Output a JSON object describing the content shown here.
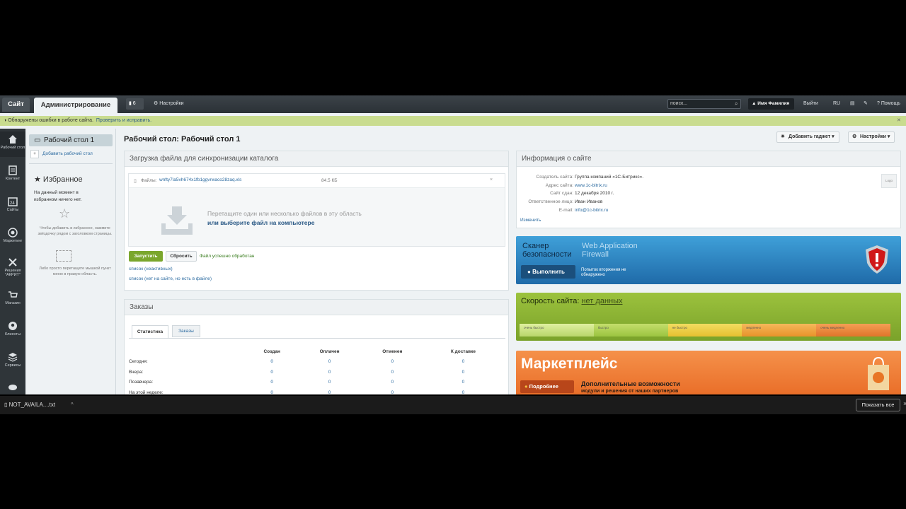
{
  "topbar": {
    "site": "Сайт",
    "admin": "Администрирование",
    "notif_count": "6",
    "settings": "Настройки",
    "search_placeholder": "поиск...",
    "user": "Имя Фамилия",
    "logout": "Выйти",
    "lang": "RU",
    "help": "Помощь"
  },
  "notice": {
    "text": "Обнаружены ошибки в работе сайта.",
    "link": "Проверить и исправить."
  },
  "leftmenu": [
    {
      "label": "Рабочий стол",
      "icon": "home-icon"
    },
    {
      "label": "Контент",
      "icon": "document-icon"
    },
    {
      "label": "Сайты",
      "icon": "calendar-icon"
    },
    {
      "label": "Маркетинг",
      "icon": "target-icon"
    },
    {
      "label": "Решения \"АКРИТ\"",
      "icon": "tools-icon"
    },
    {
      "label": "Магазин",
      "icon": "cart-icon"
    },
    {
      "label": "Клиенты",
      "icon": "clients-icon"
    },
    {
      "label": "Сервисы",
      "icon": "layers-icon"
    }
  ],
  "panel": {
    "desk": "Рабочий стол 1",
    "add_desk": "Добавить рабочий стол",
    "fav_title": "Избранное",
    "fav_empty": "На данный момент в избранном ничего нет.",
    "hint1": "Чтобы добавить в избранное, нажмите звёздочку рядом с заголовком страницы.",
    "hint2": "Либо просто перетащите мышкой пункт меню в правую область."
  },
  "main": {
    "title": "Рабочий стол: Рабочий стол 1",
    "add_gadget": "Добавить гаджет",
    "settings": "Настройки"
  },
  "upload": {
    "title": "Загрузка файла для синхронизации каталога",
    "files_label": "Файлы:",
    "file_name": "wnfty7la5vh674x1fb1ggvrwaco28zaq.xls",
    "file_size": "84.5 КБ",
    "drop_text": "Перетащите один или несколько файлов в эту область",
    "drop_link": "или выберите файл на компьютере",
    "run": "Запустить",
    "reset": "Сбросить",
    "success": "Файл успешно обработан",
    "list1": "список (неактивных)",
    "list2": "список (нет на сайте, но есть в файле)"
  },
  "orders": {
    "title": "Заказы",
    "tabs": [
      "Статистика",
      "Заказы"
    ],
    "columns": [
      "Создан",
      "Оплачен",
      "Отменен",
      "К доставке"
    ],
    "rows": [
      {
        "label": "Сегодня:",
        "values": [
          "0",
          "0",
          "0",
          "0"
        ]
      },
      {
        "label": "Вчера:",
        "values": [
          "0",
          "0",
          "0",
          "0"
        ]
      },
      {
        "label": "Позавчера:",
        "values": [
          "0",
          "0",
          "0",
          "0"
        ]
      },
      {
        "label": "На этой неделе:",
        "values": [
          "0",
          "0",
          "0",
          "0"
        ]
      }
    ]
  },
  "siteinfo": {
    "title": "Информация о сайте",
    "fields": [
      {
        "label": "Создатель сайта:",
        "value": "Группа компаний «1С-Битрикс»."
      },
      {
        "label": "Адрес сайта:",
        "value": "www.1c-bitrix.ru"
      },
      {
        "label": "Сайт сдан:",
        "value": "12 декабря 2010 г."
      },
      {
        "label": "Ответственное лицо:",
        "value": "Иван Иванов"
      },
      {
        "label": "E-mail:",
        "value": "info@1c-bitrix.ru"
      }
    ],
    "logo": "Logo",
    "edit": "Изменить"
  },
  "scanner": {
    "title1": "Сканер",
    "title2": "безопасности",
    "waf1": "Web Application",
    "waf2": "Firewall",
    "run": "Выполнить",
    "status": "Попыток вторжения не обнаружено"
  },
  "speed": {
    "title": "Скорость сайта:",
    "value": "нет данных",
    "scale": [
      "очень быстро",
      "быстро",
      "не быстро",
      "медленно",
      "очень медленно"
    ]
  },
  "market": {
    "title": "Маркетплейс",
    "more": "Подробнее",
    "sub1": "Дополнительные возможности",
    "sub2": "модули и решения от наших партнеров"
  },
  "download": {
    "file": "NOT_AVAILA....txt",
    "show_all": "Показать все"
  }
}
